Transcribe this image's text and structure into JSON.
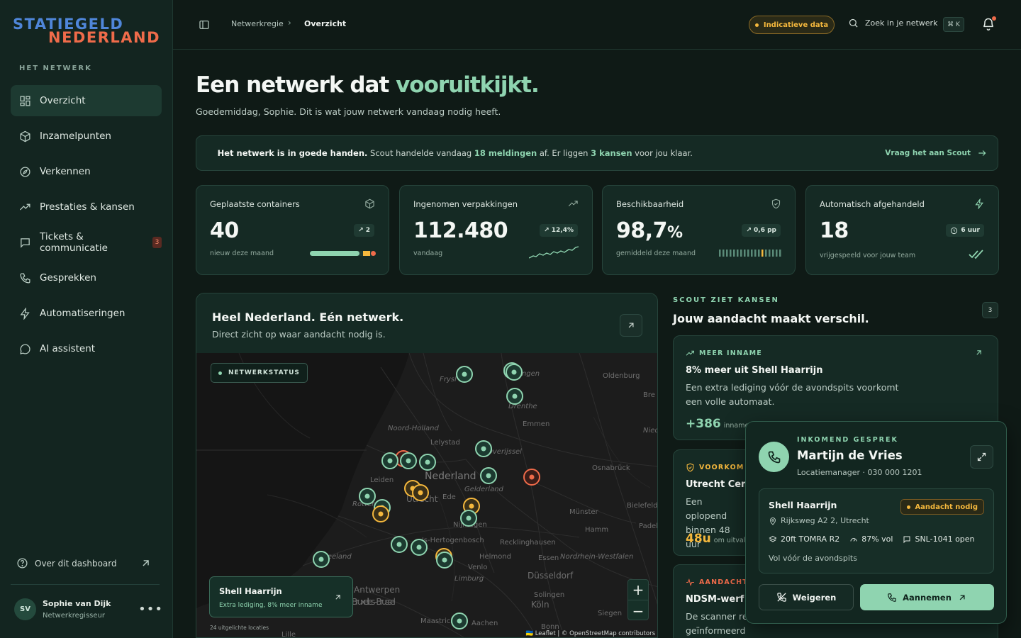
{
  "brand": {
    "line1": "STATIEGELD",
    "line2": "NEDERLAND"
  },
  "sidebar": {
    "section": "HET NETWERK",
    "items": [
      {
        "label": "Overzicht",
        "icon": "dashboard-icon",
        "active": true
      },
      {
        "label": "Inzamelpunten",
        "icon": "box-icon"
      },
      {
        "label": "Verkennen",
        "icon": "compass-icon"
      },
      {
        "label": "Prestaties & kansen",
        "icon": "trend-icon"
      },
      {
        "label": "Tickets & communicatie",
        "icon": "chat-icon",
        "badge": "3"
      },
      {
        "label": "Gesprekken",
        "icon": "phone-icon"
      },
      {
        "label": "Automatiseringen",
        "icon": "bolt-icon"
      },
      {
        "label": "AI assistent",
        "icon": "bubble-icon"
      }
    ],
    "about": "Over dit dashboard",
    "user": {
      "initials": "SV",
      "name": "Sophie van Dijk",
      "role": "Netwerkregisseur"
    }
  },
  "topbar": {
    "crumb1": "Netwerkregie",
    "crumb2": "Overzicht",
    "indicative": "Indicatieve data",
    "search": "Zoek in je netwerk",
    "shortcut": "⌘ K"
  },
  "hero": {
    "title_a": "Een netwerk dat ",
    "title_b": "vooruitkijkt.",
    "subtitle": "Goedemiddag, Sophie. Dit is wat jouw netwerk vandaag nodig heeft."
  },
  "banner": {
    "lead": "Het netwerk is in goede handen.",
    "t1": " Scout handelde vandaag ",
    "h1": "18 meldingen",
    "t2": " af. Er liggen ",
    "h2": "3 kansen",
    "t3": " voor jou klaar.",
    "cta": "Vraag het aan Scout"
  },
  "kpis": [
    {
      "title": "Geplaatste containers",
      "value": "40",
      "chip": "↗ 2",
      "sub": "nieuw deze maand",
      "bar_fill": 0.75
    },
    {
      "title": "Ingenomen verpakkingen",
      "value": "112.480",
      "chip": "↗ 12,4%",
      "sub": "vandaag"
    },
    {
      "title": "Beschikbaarheid",
      "value": "98,7",
      "unit": "%",
      "chip": "↗ 0,6 pp",
      "sub": "gemiddeld deze maand"
    },
    {
      "title": "Automatisch afgehandeld",
      "value": "18",
      "chip": "6 uur",
      "sub": "vrijgespeeld voor jouw team"
    }
  ],
  "map_panel": {
    "title": "Heel Nederland. Eén netwerk.",
    "subtitle": "Direct zicht op waar aandacht nodig is.",
    "status": "NETWERKSTATUS",
    "popup_title": "Shell Haarrijn",
    "popup_sub": "Extra lediging, 8% meer inname",
    "count_note": "24 uitgelichte locaties",
    "attribution": "🇺🇦 Leaflet | © OpenStreetMap contributors",
    "labels": [
      "Frysl",
      "Ingen",
      "Oldenburg",
      "Bre",
      "Drenthe",
      "Emmen",
      "Nied",
      "Noord-Holland",
      "Lelystad",
      "Overijssel",
      "Nederland",
      "Osnabrück",
      "Leiden",
      "Gelderland",
      "Utrecht",
      "Ede",
      "Münster",
      "Bielefeld",
      "Padeb",
      "Hamm",
      "Nijmegen",
      "Recklinghausen",
      "'s-Hertogenbosch",
      "Essen",
      "Nordrhein-Westfalen",
      "Helmond",
      "Venlo",
      "Limburg",
      "Düsseldorf",
      "Antwerpen",
      "Bruxelles - Brussel",
      "Solingen",
      "Köln",
      "Siegen",
      "Maastricht",
      "Aachen",
      "Bonn",
      "Zeeland",
      "Rotterdam",
      "Lille"
    ],
    "zoom_in": "+",
    "zoom_out": "−"
  },
  "scout": {
    "kicker": "SCOUT ZIET KANSEN",
    "title": "Jouw aandacht maakt verschil.",
    "count": "3",
    "cards": [
      {
        "kicker": "MEER INNAME",
        "title": "8% meer uit Shell Haarrijn",
        "desc": "Een extra lediging vóór de avondspits voorkomt een volle automaat.",
        "metric": "+386",
        "unit": "innames"
      },
      {
        "kicker": "VOORKOM S",
        "title": "Utrecht Cent",
        "desc": "Een oplopend binnen 48 uur",
        "metric": "48u",
        "unit": "om uitval"
      },
      {
        "kicker": "AANDACHT",
        "title": "NDSM-werf i",
        "desc": "De scanner re geïnformeerd en kijkt mee."
      }
    ]
  },
  "call": {
    "kicker": "INKOMEND GESPREK",
    "name": "Martijn de Vries",
    "role": "Locatiemanager · 030 000 1201",
    "location": "Shell Haarrijn",
    "status": "Aandacht nodig",
    "address": "Rijksweg A2 2, Utrecht",
    "machine": "20ft TOMRA R2",
    "fill": "87% vol",
    "ticket": "SNL-1041 open",
    "note": "Vol vóór de avondspits",
    "decline": "Weigeren",
    "accept": "Aannemen"
  },
  "colors": {
    "accent": "#8fd4b0",
    "warning": "#f5b83d",
    "alert": "#ef6b4a",
    "brand_blue": "#4f86d9"
  }
}
